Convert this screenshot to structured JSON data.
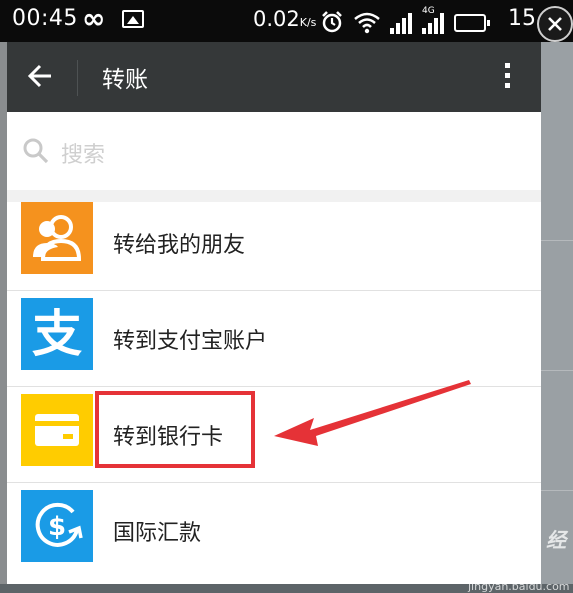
{
  "status_bar": {
    "time": "00:45",
    "speed": "0.02",
    "speed_unit": "K/s",
    "network": "4G",
    "battery_number": "15"
  },
  "app_bar": {
    "title": "转账"
  },
  "search": {
    "placeholder": "搜索"
  },
  "options": [
    {
      "label": "转给我的朋友",
      "icon": "friends-icon",
      "color": "#f5921e"
    },
    {
      "label": "转到支付宝账户",
      "icon": "alipay-icon",
      "color": "#1a9be6"
    },
    {
      "label": "转到银行卡",
      "icon": "bank-card-icon",
      "color": "#ffcc00"
    },
    {
      "label": "国际汇款",
      "icon": "international-remit-icon",
      "color": "#1a9be6"
    }
  ],
  "annotation": {
    "highlight_color": "#e53237"
  },
  "watermark": {
    "main": "Bai du 经验",
    "sub": "jingyan.baidu.com"
  }
}
